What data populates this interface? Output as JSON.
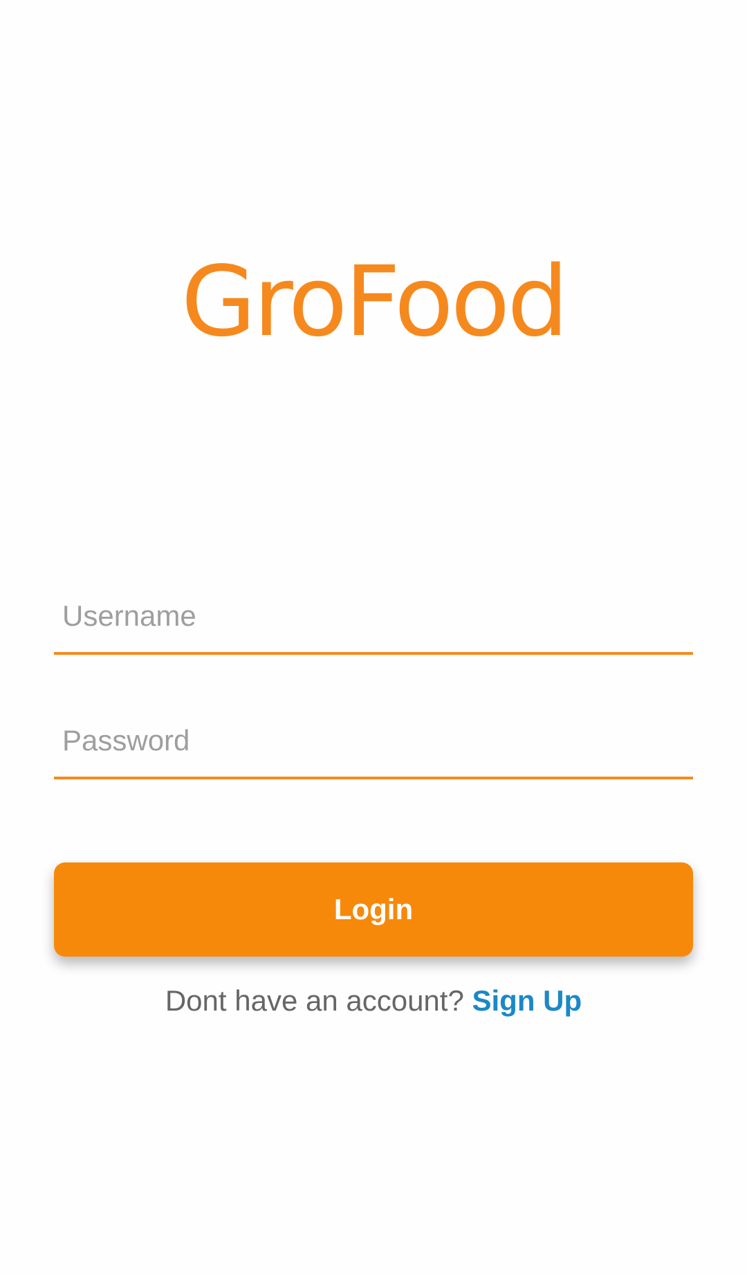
{
  "app": {
    "logo_text": "GroFood",
    "accent_color": "#f6891d",
    "link_color": "#1b88c8"
  },
  "form": {
    "username": {
      "placeholder": "Username",
      "value": ""
    },
    "password": {
      "placeholder": "Password",
      "value": ""
    },
    "login_label": "Login",
    "signup_prompt": "Dont have an account?",
    "signup_link": "Sign Up"
  }
}
